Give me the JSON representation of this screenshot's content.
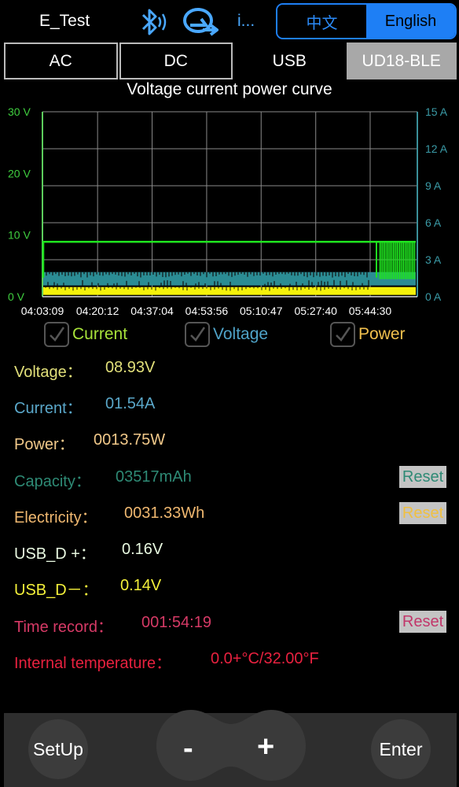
{
  "header": {
    "device_name": "E_Test",
    "more_text": "i...",
    "lang_zh": "中文",
    "lang_en": "English"
  },
  "modes": [
    "AC",
    "DC",
    "USB",
    "UD18-BLE"
  ],
  "chart_title": "Voltage current power curve",
  "chart_data": {
    "type": "line",
    "title": "Voltage current power curve",
    "x_ticks": [
      "04:03:09",
      "04:20:12",
      "04:37:04",
      "04:53:56",
      "05:10:47",
      "05:27:40",
      "05:44:30"
    ],
    "y_left_ticks": [
      "0 V",
      "10 V",
      "20 V",
      "30 V"
    ],
    "y_right_ticks": [
      "0 A",
      "3 A",
      "6 A",
      "9 A",
      "12 A",
      "15 A"
    ],
    "ylim_left": [
      0,
      30
    ],
    "ylim_right": [
      0,
      15
    ],
    "grid": true,
    "series": [
      {
        "name": "Voltage",
        "color": "#1fe31f",
        "axis": "left",
        "x": [
          "04:03:09",
          "05:44:30",
          "05:59:00"
        ],
        "values": [
          8.9,
          8.9,
          8.9
        ]
      },
      {
        "name": "Current",
        "color": "#2b8c94",
        "axis": "right",
        "x": [
          "04:03:09",
          "05:44:30"
        ],
        "values": [
          1.55,
          1.55
        ]
      },
      {
        "name": "Power",
        "color": "#f5f20a",
        "axis": "left",
        "x": [
          "04:03:09",
          "05:44:30"
        ],
        "values": [
          0.8,
          0.8
        ]
      }
    ]
  },
  "legend": [
    {
      "label": "Current",
      "color": "#a8e33a"
    },
    {
      "label": "Voltage",
      "color": "#4fa3c8"
    },
    {
      "label": "Power",
      "color": "#f2c14e"
    }
  ],
  "readouts": {
    "voltage": {
      "label": "Voltage：",
      "value": "08.93V",
      "color": "#e2e07a"
    },
    "current": {
      "label": "Current：",
      "value": "01.54A",
      "color": "#5aa7c9"
    },
    "power": {
      "label": "Power：",
      "value": "0013.75W",
      "color": "#f2c98a"
    },
    "capacity": {
      "label": "Capacity：",
      "value": "03517mAh",
      "color": "#2e8a75",
      "reset": "Reset",
      "reset_color": "#2e8a75"
    },
    "electricity": {
      "label": "Electricity：",
      "value": "0031.33Wh",
      "color": "#f0b870",
      "reset": "Reset",
      "reset_color": "#f0c040"
    },
    "usb_dp": {
      "label": "USB_D +：",
      "value": "0.16V",
      "color": "#e8f8e0"
    },
    "usb_dm": {
      "label": "USB_D－：",
      "value": "0.14V",
      "color": "#f4f03a"
    },
    "time_record": {
      "label": "Time record：",
      "value": "001:54:19",
      "color": "#d63a66",
      "reset": "Reset",
      "reset_color": "#c2366a"
    },
    "temperature": {
      "label": "Internal temperature：",
      "value": "0.0+°C/32.00°F",
      "color": "#e8213f"
    }
  },
  "bottom": {
    "setup": "SetUp",
    "minus": "-",
    "plus": "+",
    "enter": "Enter"
  }
}
